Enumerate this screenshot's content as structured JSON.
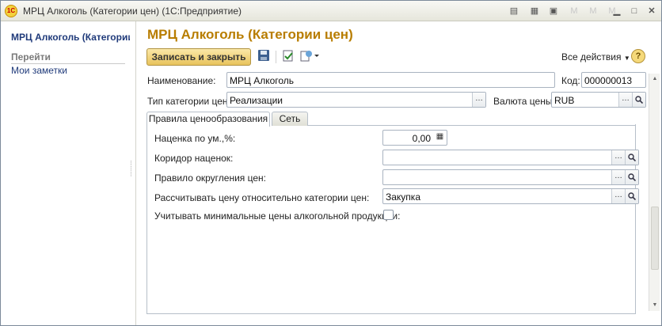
{
  "window": {
    "title": "МРЦ Алкоголь (Категории цен)  (1С:Предприятие)",
    "titlebar_icons": [
      "document-icon",
      "calculator-icon",
      "calendar-icon",
      "memory-m-icon",
      "memory-m-plus-icon",
      "memory-m-minus-icon",
      "minimize-icon",
      "maximize-icon",
      "close-icon"
    ],
    "logo_text": "1С"
  },
  "sidebar": {
    "title": "МРЦ Алкоголь (Категории цен)",
    "section_label": "Перейти",
    "items": [
      {
        "label": "Мои заметки"
      }
    ]
  },
  "form": {
    "title": "МРЦ Алкоголь (Категории цен)",
    "toolbar": {
      "save_close_label": "Записать и закрыть",
      "all_actions_label": "Все действия",
      "help_label": "?"
    },
    "name": {
      "label": "Наименование:",
      "value": "МРЦ Алкоголь"
    },
    "code": {
      "label": "Код:",
      "value": "000000013"
    },
    "price_type": {
      "label": "Тип категории цен:",
      "value": "Реализации"
    },
    "currency": {
      "label": "Валюта цены:",
      "value": "RUB"
    },
    "tabs": [
      {
        "label": "Правила ценообразования",
        "active": true
      },
      {
        "label": "Сеть",
        "active": false
      }
    ],
    "rules": {
      "markup": {
        "label": "Наценка по ум.,%:",
        "value": "0,00"
      },
      "markup_corridor": {
        "label": "Коридор наценок:",
        "value": ""
      },
      "rounding_rule": {
        "label": "Правило округления цен:",
        "value": ""
      },
      "relative_category": {
        "label": "Рассчитывать цену относительно категории цен:",
        "value": "Закупка"
      },
      "min_alcohol_prices": {
        "label": "Учитывать минимальные цены алкогольной продукции:",
        "checked": false
      }
    }
  },
  "colors": {
    "title_accent": "#b87d00",
    "link": "#1f3a7a",
    "primary_button": "#e8c35c"
  }
}
